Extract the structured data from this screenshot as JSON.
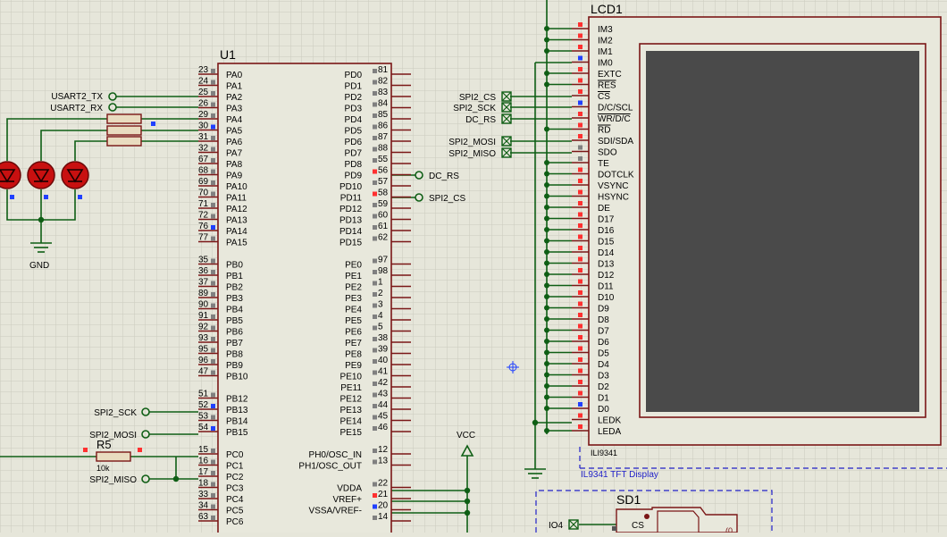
{
  "u1": {
    "name": "U1",
    "left_pins": [
      {
        "num": "23",
        "name": "PA0"
      },
      {
        "num": "24",
        "name": "PA1"
      },
      {
        "num": "25",
        "name": "PA2"
      },
      {
        "num": "26",
        "name": "PA3"
      },
      {
        "num": "29",
        "name": "PA4"
      },
      {
        "num": "30",
        "name": "PA5"
      },
      {
        "num": "31",
        "name": "PA6"
      },
      {
        "num": "32",
        "name": "PA7"
      },
      {
        "num": "67",
        "name": "PA8"
      },
      {
        "num": "68",
        "name": "PA9"
      },
      {
        "num": "69",
        "name": "PA10"
      },
      {
        "num": "70",
        "name": "PA11"
      },
      {
        "num": "71",
        "name": "PA12"
      },
      {
        "num": "72",
        "name": "PA13"
      },
      {
        "num": "76",
        "name": "PA14"
      },
      {
        "num": "77",
        "name": "PA15"
      },
      {
        "num": "35",
        "name": "PB0"
      },
      {
        "num": "36",
        "name": "PB1"
      },
      {
        "num": "37",
        "name": "PB2"
      },
      {
        "num": "89",
        "name": "PB3"
      },
      {
        "num": "90",
        "name": "PB4"
      },
      {
        "num": "91",
        "name": "PB5"
      },
      {
        "num": "92",
        "name": "PB6"
      },
      {
        "num": "93",
        "name": "PB7"
      },
      {
        "num": "95",
        "name": "PB8"
      },
      {
        "num": "96",
        "name": "PB9"
      },
      {
        "num": "47",
        "name": "PB10"
      },
      {
        "num": "51",
        "name": "PB12"
      },
      {
        "num": "52",
        "name": "PB13"
      },
      {
        "num": "53",
        "name": "PB14"
      },
      {
        "num": "54",
        "name": "PB15"
      },
      {
        "num": "15",
        "name": "PC0"
      },
      {
        "num": "16",
        "name": "PC1"
      },
      {
        "num": "17",
        "name": "PC2"
      },
      {
        "num": "18",
        "name": "PC3"
      },
      {
        "num": "33",
        "name": "PC4"
      },
      {
        "num": "34",
        "name": "PC5"
      },
      {
        "num": "63",
        "name": "PC6"
      }
    ],
    "right_pins": [
      {
        "num": "81",
        "name": "PD0"
      },
      {
        "num": "82",
        "name": "PD1"
      },
      {
        "num": "83",
        "name": "PD2"
      },
      {
        "num": "84",
        "name": "PD3"
      },
      {
        "num": "85",
        "name": "PD4"
      },
      {
        "num": "86",
        "name": "PD5"
      },
      {
        "num": "87",
        "name": "PD6"
      },
      {
        "num": "88",
        "name": "PD7"
      },
      {
        "num": "55",
        "name": "PD8"
      },
      {
        "num": "56",
        "name": "PD9"
      },
      {
        "num": "57",
        "name": "PD10"
      },
      {
        "num": "58",
        "name": "PD11"
      },
      {
        "num": "59",
        "name": "PD12"
      },
      {
        "num": "60",
        "name": "PD13"
      },
      {
        "num": "61",
        "name": "PD14"
      },
      {
        "num": "62",
        "name": "PD15"
      },
      {
        "num": "97",
        "name": "PE0"
      },
      {
        "num": "98",
        "name": "PE1"
      },
      {
        "num": "1",
        "name": "PE2"
      },
      {
        "num": "2",
        "name": "PE3"
      },
      {
        "num": "3",
        "name": "PE4"
      },
      {
        "num": "4",
        "name": "PE5"
      },
      {
        "num": "5",
        "name": "PE6"
      },
      {
        "num": "38",
        "name": "PE7"
      },
      {
        "num": "39",
        "name": "PE8"
      },
      {
        "num": "40",
        "name": "PE9"
      },
      {
        "num": "41",
        "name": "PE10"
      },
      {
        "num": "42",
        "name": "PE11"
      },
      {
        "num": "43",
        "name": "PE12"
      },
      {
        "num": "44",
        "name": "PE13"
      },
      {
        "num": "45",
        "name": "PE14"
      },
      {
        "num": "46",
        "name": "PE15"
      },
      {
        "num": "12",
        "name": "PH0/OSC_IN"
      },
      {
        "num": "13",
        "name": "PH1/OSC_OUT"
      },
      {
        "num": "22",
        "name": "VDDA"
      },
      {
        "num": "21",
        "name": "VREF+"
      },
      {
        "num": "20",
        "name": "VSSA/VREF-"
      },
      {
        "num": "14",
        "name": ""
      }
    ]
  },
  "lcd": {
    "name": "LCD1",
    "part": "ILI9341",
    "desc": "IL9341 TFT Display",
    "pins": [
      "IM3",
      "IM2",
      "IM1",
      "IM0",
      "EXTC",
      "RES",
      "CS",
      "D/C/SCL",
      "WR/D/C",
      "RD",
      "SDI/SDA",
      "SDO",
      "TE",
      "DOTCLK",
      "VSYNC",
      "HSYNC",
      "DE",
      "D17",
      "D16",
      "D15",
      "D14",
      "D13",
      "D12",
      "D11",
      "D10",
      "D9",
      "D8",
      "D7",
      "D6",
      "D5",
      "D4",
      "D3",
      "D2",
      "D1",
      "D0",
      "LEDK",
      "LEDA"
    ]
  },
  "left_terminals": {
    "usart_tx": "USART2_TX",
    "usart_rx": "USART2_RX",
    "spi_sck": "SPI2_SCK",
    "spi_mosi": "SPI2_MOSI",
    "spi_miso": "SPI2_MISO"
  },
  "pd_terminals": {
    "dc_rs": "DC_RS",
    "spi_cs": "SPI2_CS"
  },
  "lcd_terminals": [
    "SPI2_CS",
    "SPI2_SCK",
    "DC_RS",
    "SPI2_MOSI",
    "SPI2_MISO"
  ],
  "gnd_label": "GND",
  "vcc_label": "VCC",
  "r5": {
    "name": "R5",
    "value": "10k"
  },
  "sd": {
    "name": "SD1",
    "pin": "CS",
    "terminal": "IO4",
    "partial": "(0"
  },
  "colors": {
    "background": "#e6e6da",
    "grid": "#cbcbbd",
    "wire": "#0e5e14",
    "body": "#7a1616",
    "body_fill": "#e8e8dc",
    "led": "#d01010",
    "pin_red": "#ff3030",
    "pin_blue": "#2040ff",
    "screen": "#4a4a4a",
    "dashed": "#2020c8"
  }
}
